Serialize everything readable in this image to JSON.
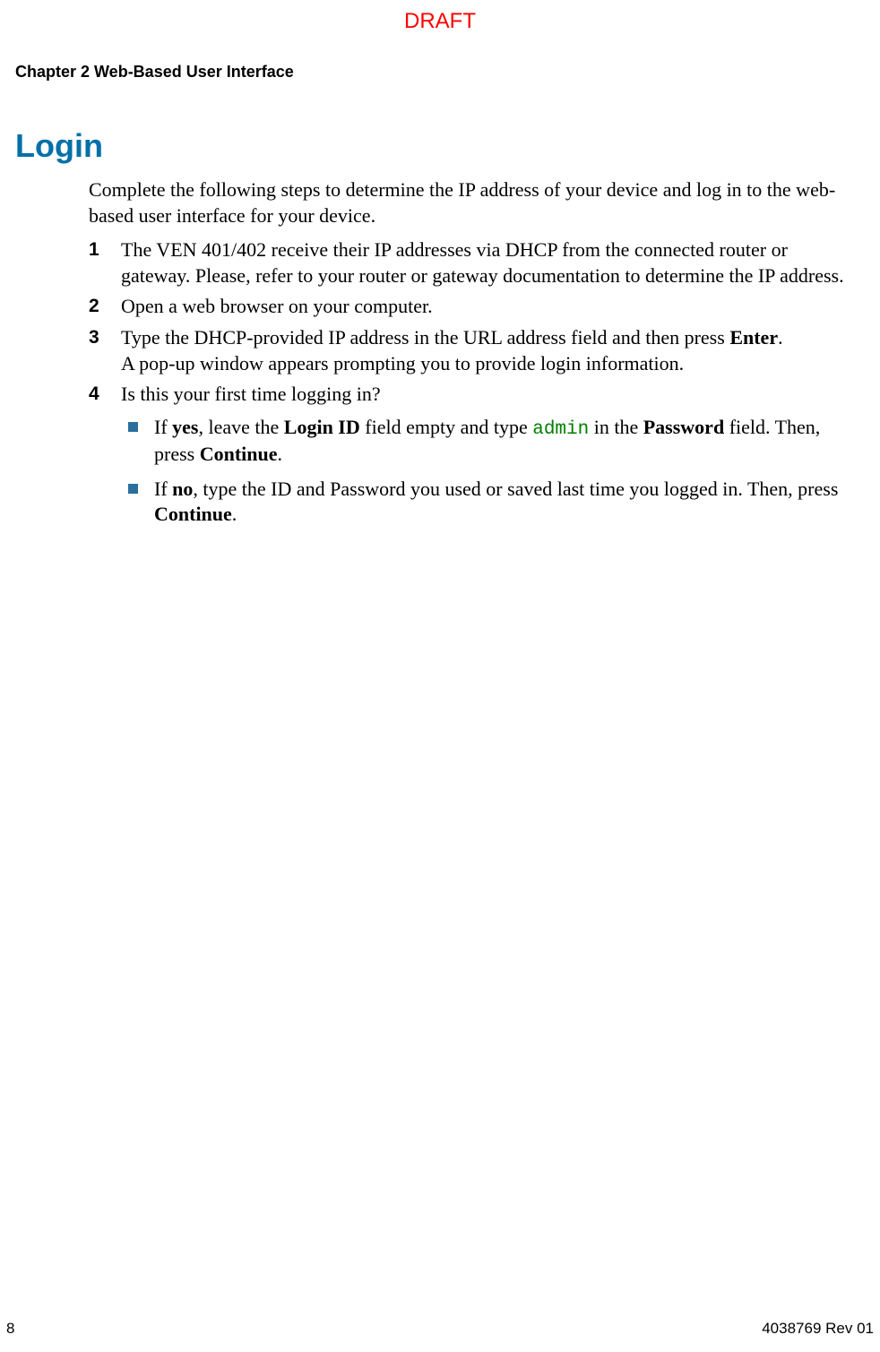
{
  "draft": "DRAFT",
  "chapter": "Chapter 2    Web-Based User Interface",
  "section_title": "Login",
  "intro": "Complete the following steps to determine the IP address of your device and log in to the web-based user interface for your device.",
  "steps": {
    "s1": {
      "num": "1",
      "text": "The VEN 401/402 receive their IP addresses via DHCP from the connected router or gateway. Please, refer to your router or gateway documentation to determine the IP address."
    },
    "s2": {
      "num": "2",
      "text": "Open a web browser on your computer."
    },
    "s3": {
      "num": "3",
      "text_before": "Type the DHCP-provided IP address in the URL address field and then press ",
      "bold1": "Enter",
      "text_after1": ".",
      "line2": "A pop-up window appears prompting you to provide login information."
    },
    "s4": {
      "num": "4",
      "text": "Is this your first time logging in?",
      "bullet1": {
        "p1": "If ",
        "b1": "yes",
        "p2": ", leave the ",
        "b2": "Login ID",
        "p3": " field empty and type ",
        "code": "admin",
        "p4": " in the ",
        "b3": "Password",
        "p5": " field. Then, press ",
        "b4": "Continue",
        "p6": "."
      },
      "bullet2": {
        "p1": "If ",
        "b1": "no",
        "p2": ", type the ID and Password you used or saved last time you logged in. Then, press ",
        "b2": "Continue",
        "p3": "."
      }
    }
  },
  "footer": {
    "page": "8",
    "docref": "4038769 Rev 01"
  }
}
